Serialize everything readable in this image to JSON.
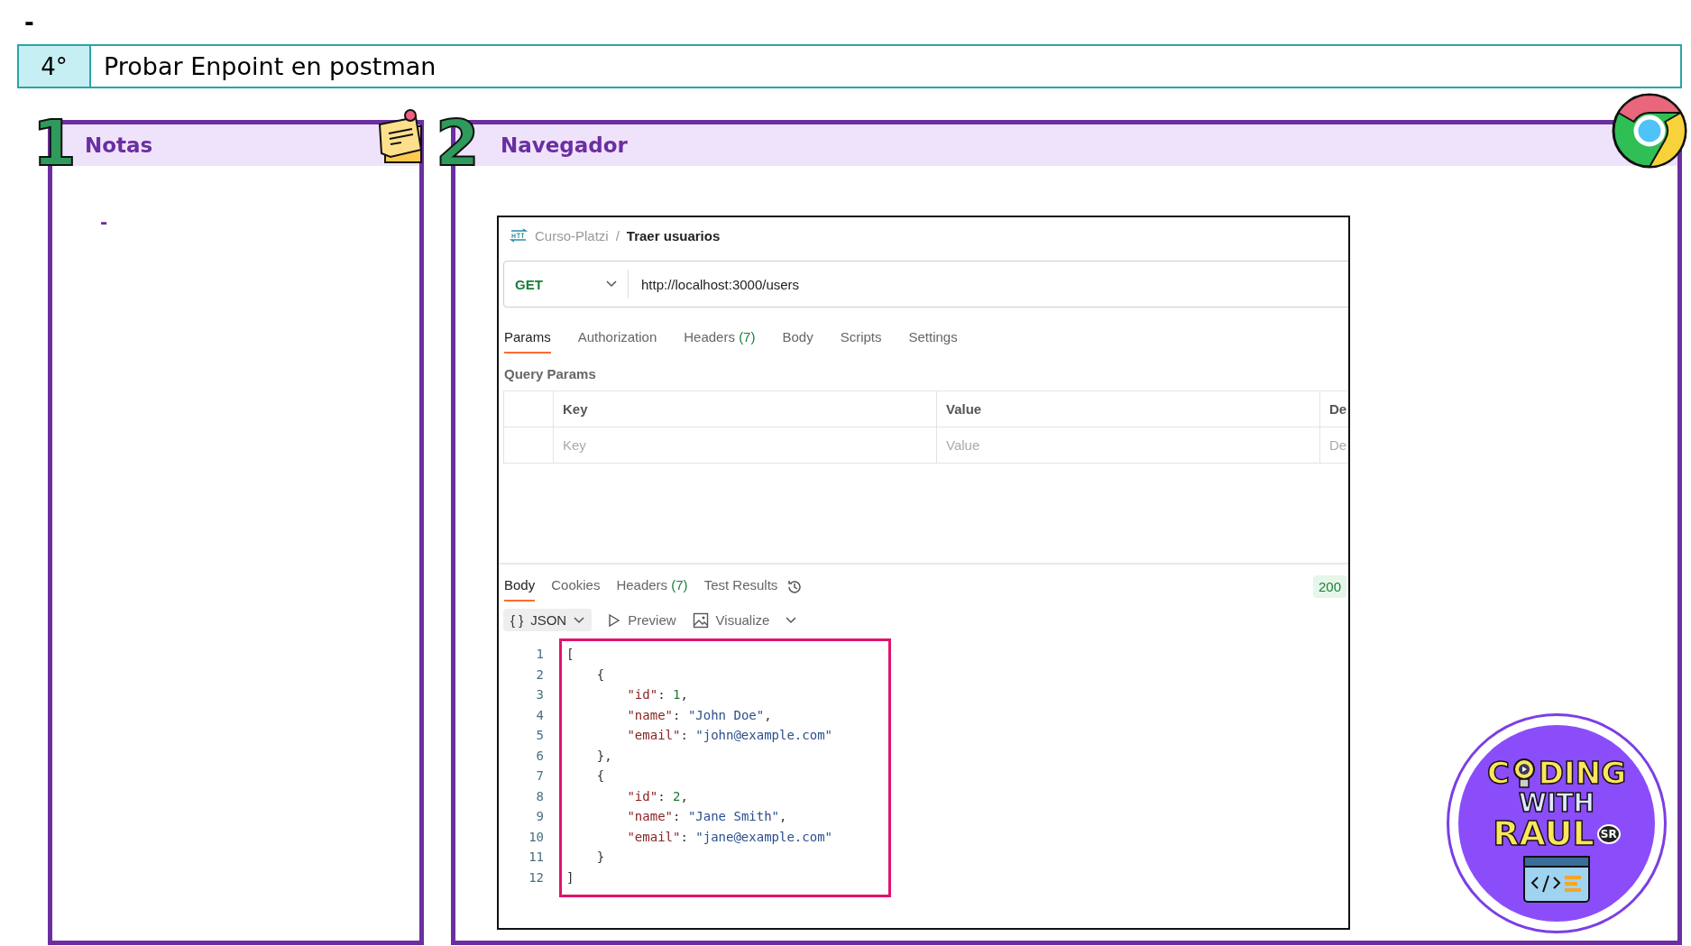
{
  "top_mark": "-",
  "step": {
    "number": "4°",
    "title": "Probar Enpoint en postman"
  },
  "notes_panel": {
    "number": "1",
    "title": "Notas",
    "items": [
      "-"
    ]
  },
  "browser_panel": {
    "number": "2",
    "title": "Navegador"
  },
  "postman": {
    "breadcrumb": {
      "collection": "Curso-Platzi",
      "separator": "/",
      "request": "Traer usuarios"
    },
    "method": "GET",
    "url": "http://localhost:3000/users",
    "request_tabs": [
      {
        "label": "Params",
        "selected": true
      },
      {
        "label": "Authorization",
        "selected": false
      },
      {
        "label": "Headers",
        "count": "(7)",
        "selected": false
      },
      {
        "label": "Body",
        "selected": false
      },
      {
        "label": "Scripts",
        "selected": false
      },
      {
        "label": "Settings",
        "selected": false
      }
    ],
    "query_params": {
      "title": "Query Params",
      "columns": [
        "Key",
        "Value",
        "De"
      ],
      "placeholders": [
        "Key",
        "Value",
        "De"
      ]
    },
    "response_tabs": [
      {
        "label": "Body",
        "selected": true
      },
      {
        "label": "Cookies",
        "selected": false
      },
      {
        "label": "Headers",
        "count": "(7)",
        "selected": false
      },
      {
        "label": "Test Results",
        "selected": false
      }
    ],
    "status": "200",
    "format": {
      "braces": "{ }",
      "label": "JSON"
    },
    "view_buttons": [
      "Preview",
      "Visualize"
    ],
    "code_lines": [
      {
        "number": "1",
        "tokens": [
          {
            "kind": "punct",
            "text": "["
          }
        ]
      },
      {
        "number": "2",
        "tokens": [
          {
            "kind": "punct",
            "text": "    {"
          }
        ]
      },
      {
        "number": "3",
        "tokens": [
          {
            "kind": "key",
            "text": "        \"id\""
          },
          {
            "kind": "punct",
            "text": ": "
          },
          {
            "kind": "number",
            "text": "1"
          },
          {
            "kind": "punct",
            "text": ","
          }
        ]
      },
      {
        "number": "4",
        "tokens": [
          {
            "kind": "key",
            "text": "        \"name\""
          },
          {
            "kind": "punct",
            "text": ": "
          },
          {
            "kind": "string",
            "text": "\"John Doe\""
          },
          {
            "kind": "punct",
            "text": ","
          }
        ]
      },
      {
        "number": "5",
        "tokens": [
          {
            "kind": "key",
            "text": "        \"email\""
          },
          {
            "kind": "punct",
            "text": ": "
          },
          {
            "kind": "string",
            "text": "\"john@example.com\""
          }
        ]
      },
      {
        "number": "6",
        "tokens": [
          {
            "kind": "punct",
            "text": "    },"
          }
        ]
      },
      {
        "number": "7",
        "tokens": [
          {
            "kind": "punct",
            "text": "    {"
          }
        ]
      },
      {
        "number": "8",
        "tokens": [
          {
            "kind": "key",
            "text": "        \"id\""
          },
          {
            "kind": "punct",
            "text": ": "
          },
          {
            "kind": "number",
            "text": "2"
          },
          {
            "kind": "punct",
            "text": ","
          }
        ]
      },
      {
        "number": "9",
        "tokens": [
          {
            "kind": "key",
            "text": "        \"name\""
          },
          {
            "kind": "punct",
            "text": ": "
          },
          {
            "kind": "string",
            "text": "\"Jane Smith\""
          },
          {
            "kind": "punct",
            "text": ","
          }
        ]
      },
      {
        "number": "10",
        "tokens": [
          {
            "kind": "key",
            "text": "        \"email\""
          },
          {
            "kind": "punct",
            "text": ": "
          },
          {
            "kind": "string",
            "text": "\"jane@example.com\""
          }
        ]
      },
      {
        "number": "11",
        "tokens": [
          {
            "kind": "punct",
            "text": "    }"
          }
        ]
      },
      {
        "number": "12",
        "tokens": [
          {
            "kind": "punct",
            "text": "]"
          }
        ]
      }
    ]
  },
  "logo": {
    "line1_start": "C",
    "line1_end": "DING",
    "line2": "WITH",
    "line3": "RAUL",
    "badge": "SR"
  }
}
